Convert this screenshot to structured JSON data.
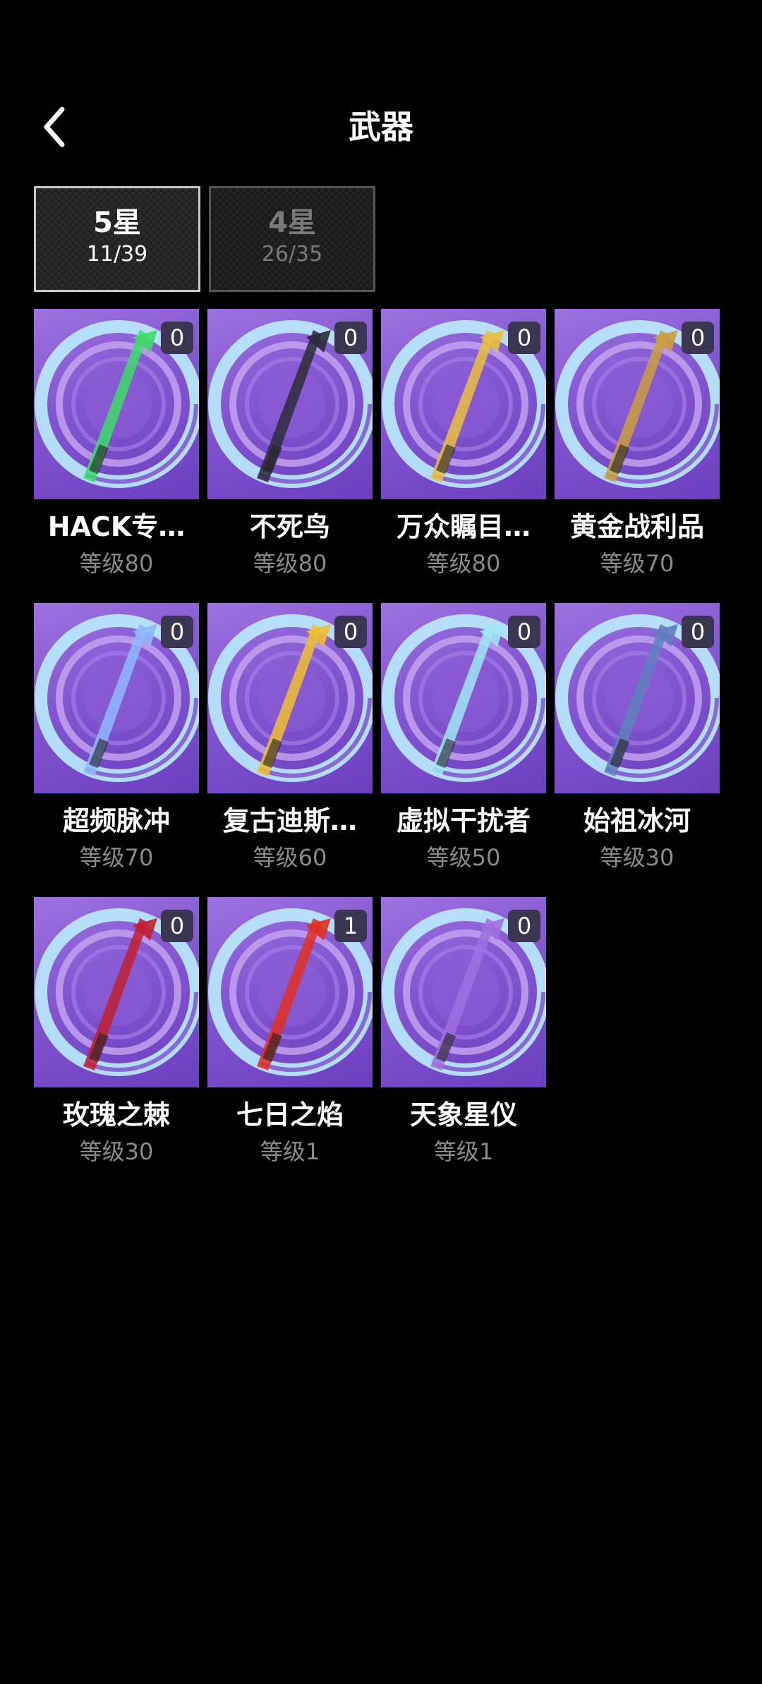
{
  "header": {
    "title": "武器",
    "back_icon": "chevron-left-icon"
  },
  "tabs": [
    {
      "label": "5星",
      "count": "11/39",
      "active": true
    },
    {
      "label": "4星",
      "count": "26/35",
      "active": false
    }
  ],
  "weapons": [
    {
      "name": "HACK专…",
      "level": "等级80",
      "badge": "0",
      "item_icon": "hacker-laptop-icon",
      "accent": "#3fdc6a"
    },
    {
      "name": "不死鸟",
      "level": "等级80",
      "badge": "0",
      "item_icon": "curved-blade-icon",
      "accent": "#2b2b3a"
    },
    {
      "name": "万众瞩目…",
      "level": "等级80",
      "badge": "0",
      "item_icon": "guitar-spear-icon",
      "accent": "#e8c040"
    },
    {
      "name": "黄金战利品",
      "level": "等级70",
      "badge": "0",
      "item_icon": "golden-scythe-icon",
      "accent": "#c9a040"
    },
    {
      "name": "超频脉冲",
      "level": "等级70",
      "badge": "0",
      "item_icon": "crystal-dagger-icon",
      "accent": "#8fb8ff"
    },
    {
      "name": "复古迪斯…",
      "level": "等级60",
      "badge": "0",
      "item_icon": "flip-phone-disco-icon",
      "accent": "#f0c030"
    },
    {
      "name": "虚拟干扰者",
      "level": "等级50",
      "badge": "0",
      "item_icon": "ice-swirl-icon",
      "accent": "#9ee6f5"
    },
    {
      "name": "始祖冰河",
      "level": "等级30",
      "badge": "0",
      "item_icon": "ice-axe-icon",
      "accent": "#6080c0"
    },
    {
      "name": "玫瑰之棘",
      "level": "等级30",
      "badge": "0",
      "item_icon": "rose-staff-icon",
      "accent": "#c02030"
    },
    {
      "name": "七日之焰",
      "level": "等级1",
      "badge": "1",
      "item_icon": "flame-blade-icon",
      "accent": "#e03020"
    },
    {
      "name": "天象星仪",
      "level": "等级1",
      "badge": "0",
      "item_icon": "star-dagger-icon",
      "accent": "#a070e0"
    }
  ],
  "colors": {
    "background": "#000000",
    "card_purple": "#8355d1",
    "ring_light": "#b9ecff",
    "level_text": "#8a8a8a",
    "badge_bg": "#3a3550"
  }
}
